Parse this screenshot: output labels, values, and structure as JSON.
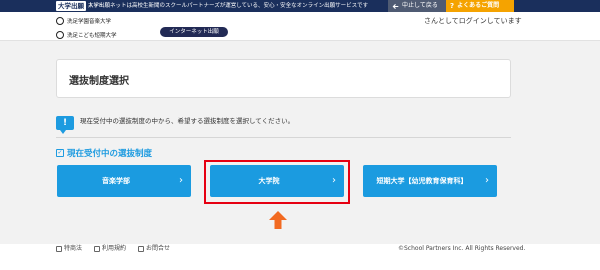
{
  "topbar": {
    "brand": "大学出願",
    "brand_sub": "ネット",
    "description": "大学出願ネットは高校生新聞のスクールパートナーズが運営している、安心・安全なオンライン出願サービスです",
    "back_button": "中止して戻る",
    "faq_button": "よくあるご質問"
  },
  "header": {
    "schools": [
      "洗足学園音楽大学",
      "洗足こども短期大学"
    ],
    "badge": "インターネット出願",
    "login_status": "さんとしてログインしています"
  },
  "page": {
    "title": "選抜制度選択",
    "notice": "現在受付中の選抜制度の中から、希望する選抜制度を選択してください。",
    "section_title": "現在受付中の選抜制度",
    "options": [
      {
        "label": "音楽学部"
      },
      {
        "label": "大学院"
      },
      {
        "label": "短期大学【幼児教育保育科】"
      }
    ],
    "highlight_color": "#e60012",
    "arrow_color": "#f26a21"
  },
  "footer": {
    "links": [
      "特商法",
      "利用規約",
      "お問合せ"
    ],
    "copyright": "©School Partners Inc. All Rights Reserved."
  },
  "colors": {
    "primary": "#1b9be0",
    "topbar": "#1a2f5c",
    "faq": "#f5a300"
  }
}
